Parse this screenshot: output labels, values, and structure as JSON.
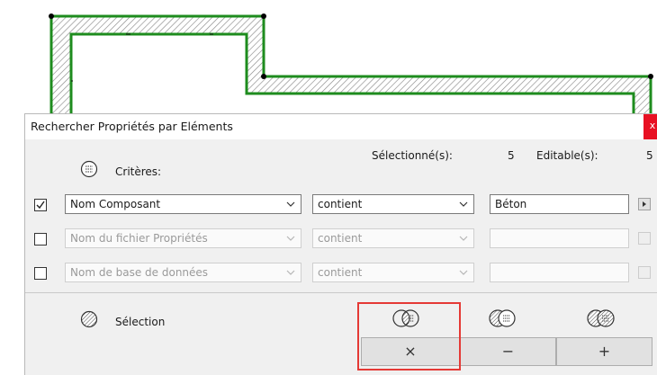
{
  "dialog": {
    "title": "Rechercher Propriétés par Eléments",
    "close_glyph": "x",
    "selected_label": "Sélectionné(s):",
    "selected_count": "5",
    "editable_label": "Editable(s):",
    "editable_count": "5",
    "criteria_label": "Critères:",
    "criteria_icon": "list-icon",
    "rows": [
      {
        "checked": true,
        "property": "Nom Composant",
        "operator": "contient",
        "value": "Béton",
        "enabled": true
      },
      {
        "checked": false,
        "property": "Nom du fichier Propriétés",
        "operator": "contient",
        "value": "",
        "enabled": false
      },
      {
        "checked": false,
        "property": "Nom de base de données",
        "operator": "contient",
        "value": "",
        "enabled": false
      }
    ],
    "selection_label": "Sélection",
    "selection_icon": "hatched-circle-icon",
    "buttons": [
      {
        "name": "intersect",
        "label": "×"
      },
      {
        "name": "subtract",
        "label": "−"
      },
      {
        "name": "add",
        "label": "+"
      }
    ]
  },
  "colors": {
    "wall_outline": "#1e8c1e",
    "hatch": "#8a8a8a",
    "highlight": "#e53935",
    "close": "#e81123"
  }
}
